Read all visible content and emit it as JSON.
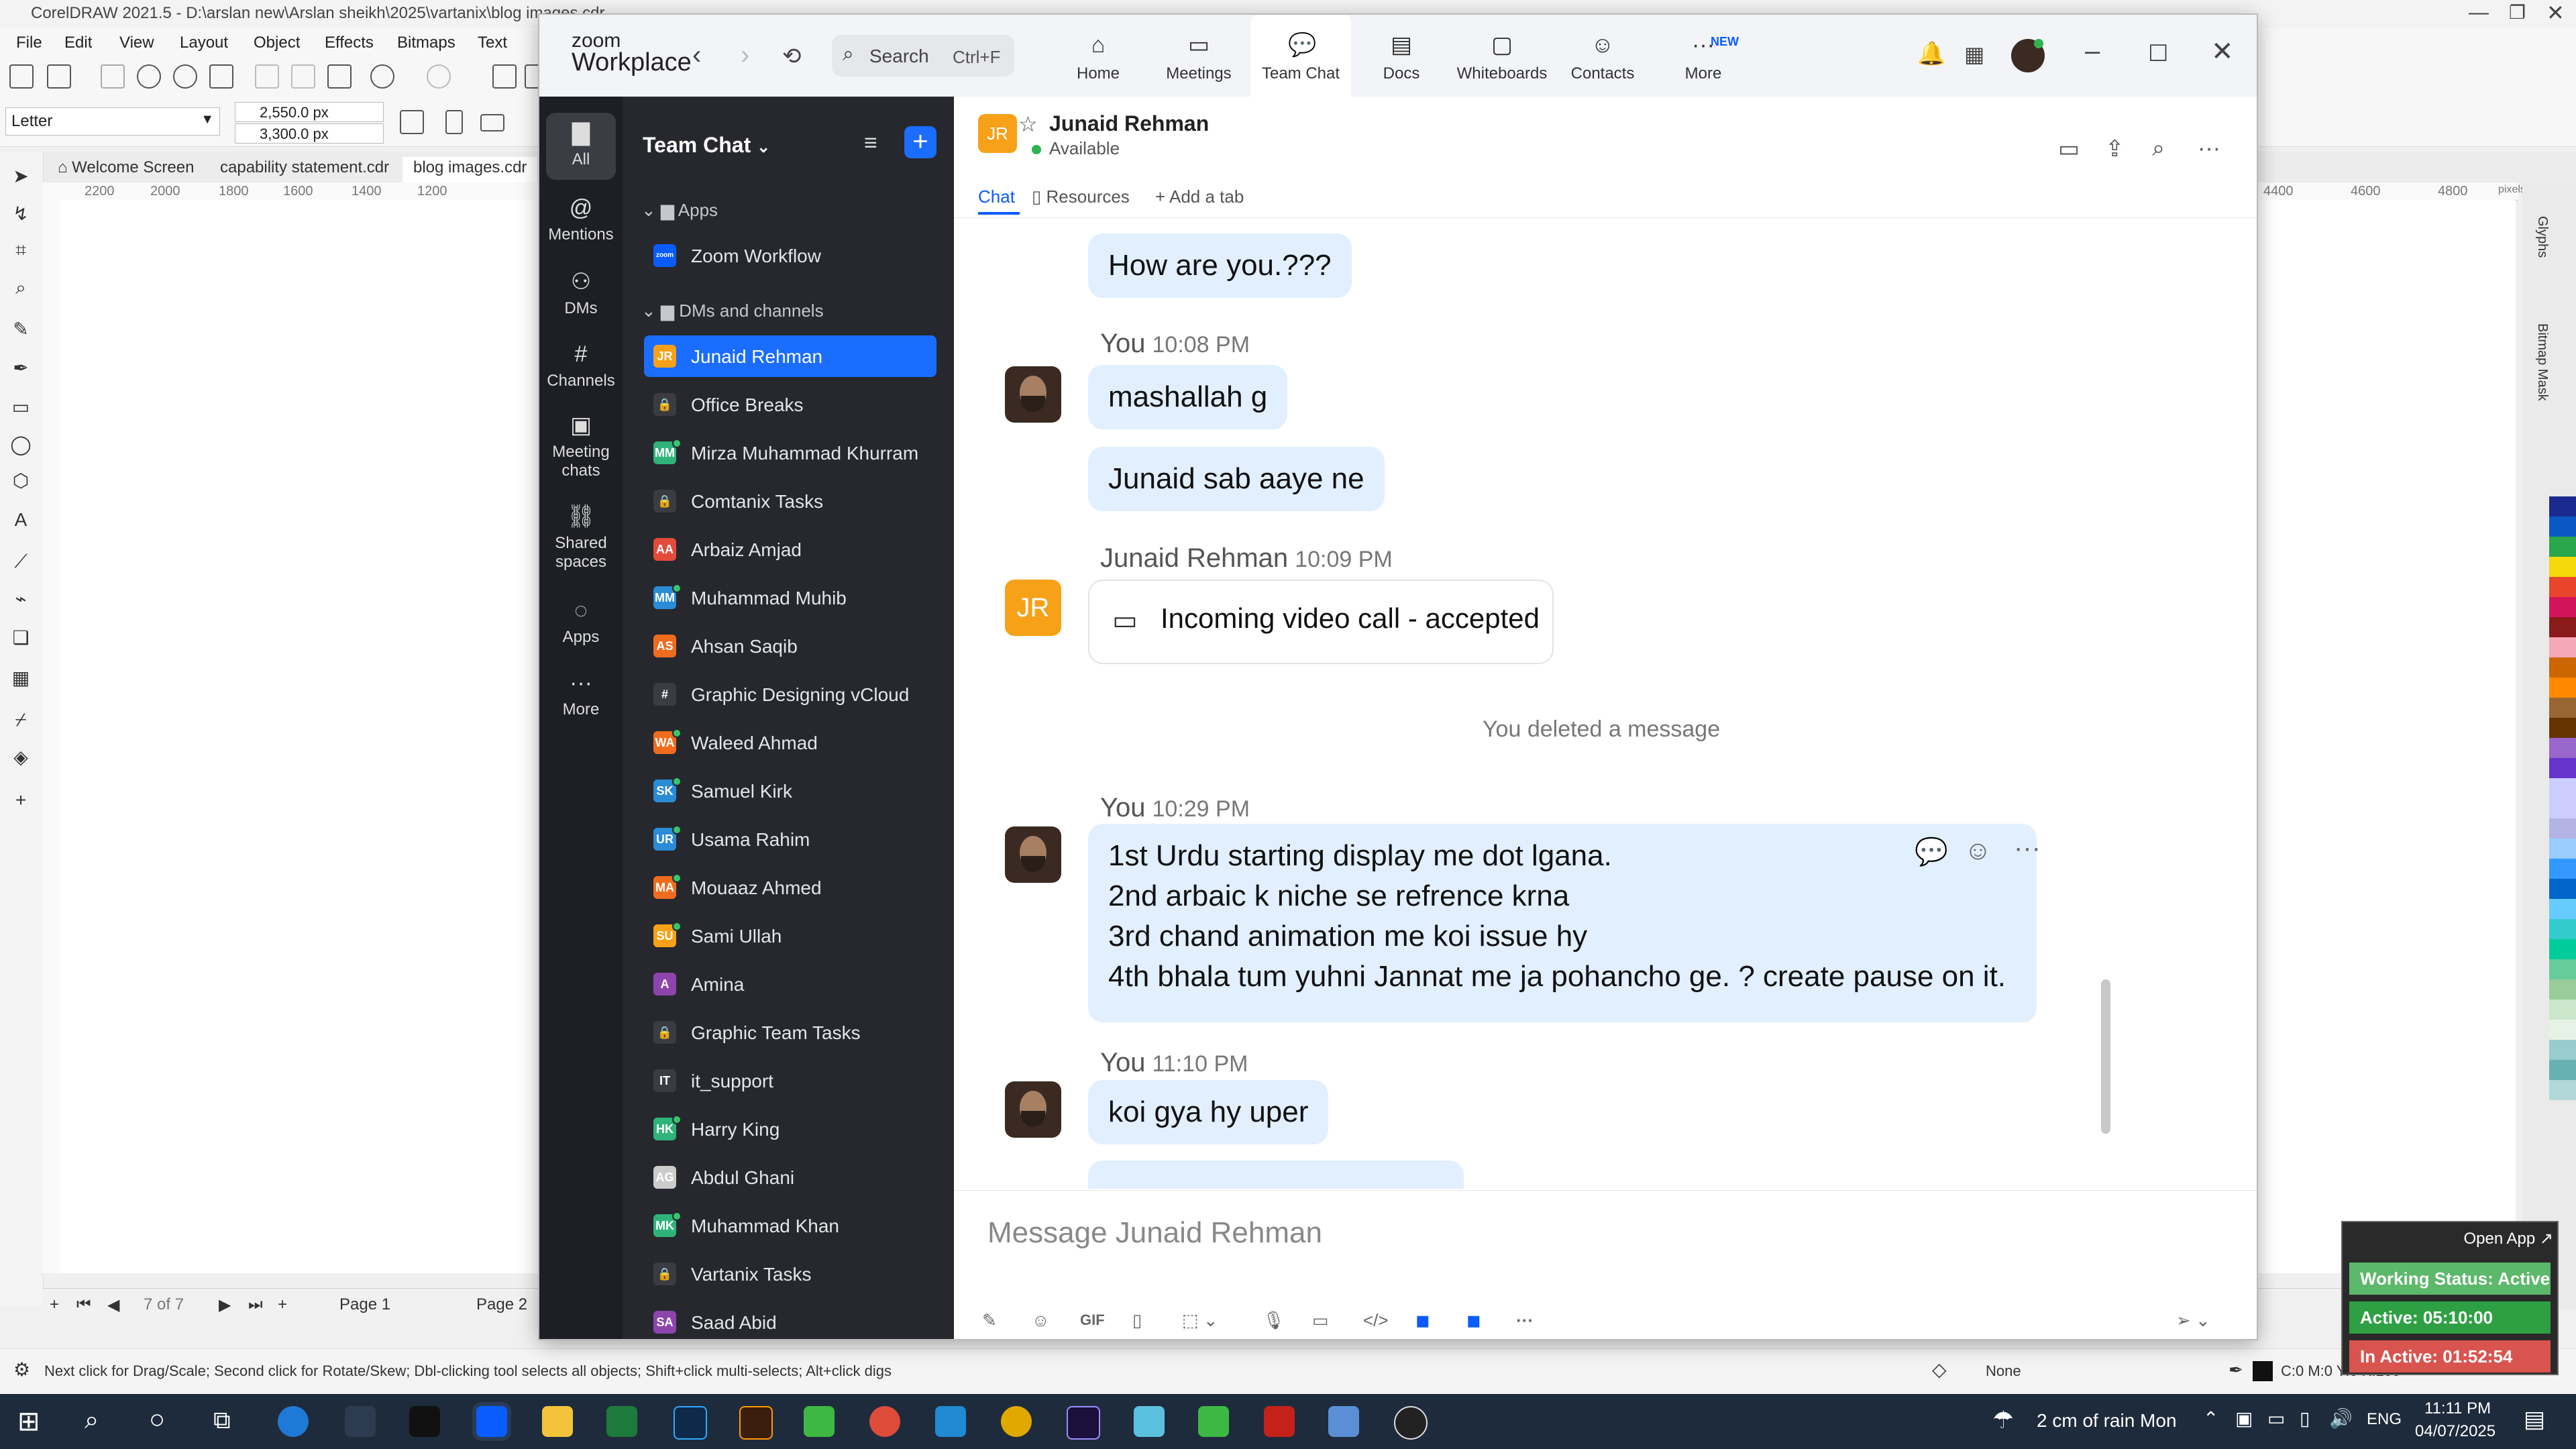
{
  "corel": {
    "title": "CorelDRAW 2021.5 - D:\\arslan new\\Arslan sheikh\\2025\\vartanix\\blog images.cdr",
    "menu": [
      "File",
      "Edit",
      "View",
      "Layout",
      "Object",
      "Effects",
      "Bitmaps",
      "Text"
    ],
    "paper_size": "Letter",
    "width_value": "2,550.0 px",
    "height_value": "3,300.0 px",
    "doc_tabs": [
      "Welcome Screen",
      "capability statement.cdr",
      "blog images.cdr"
    ],
    "ruler_left": [
      "2200",
      "2000",
      "1800",
      "1600",
      "1400",
      "1200"
    ],
    "ruler_right": [
      "4400",
      "4600",
      "4800"
    ],
    "ruler_unit": "pixels",
    "page_counter": "7 of 7",
    "pages": [
      "Page 1",
      "Page 2"
    ],
    "docker_labels": [
      "Glyphs",
      "Bitmap Mask"
    ],
    "status_hint": "Next click for Drag/Scale; Second click for Rotate/Skew; Dbl-clicking tool selects all objects; Shift+click multi-selects; Alt+click digs",
    "fill_none": "None",
    "color_readout": "C:0 M:0 Y:0 K:100",
    "palette": [
      "#1b2a8f",
      "#0b58c4",
      "#2aa64b",
      "#f5d90a",
      "#e8452c",
      "#d4145a",
      "#8b1a1a",
      "#f7a8b8",
      "#cc6600",
      "#ff8800",
      "#996633",
      "#663300",
      "#9966cc",
      "#6633cc",
      "#ccccff",
      "#ccccff",
      "#b3b3e6",
      "#99ccff",
      "#3399ff",
      "#0066cc",
      "#66ccff",
      "#33cccc",
      "#00cc99",
      "#66cc99",
      "#99cc99",
      "#cce6cc",
      "#e6f2e6",
      "#99cccc",
      "#66b2b2",
      "#b2d8d8"
    ]
  },
  "zoom": {
    "brand_top": "zoom",
    "brand_bottom": "Workplace",
    "search_label": "Search",
    "search_shortcut": "Ctrl+F",
    "nav": [
      {
        "label": "Home",
        "icon": "home-icon"
      },
      {
        "label": "Meetings",
        "icon": "video-camera-icon"
      },
      {
        "label": "Team Chat",
        "icon": "chat-bubbles-icon"
      },
      {
        "label": "Docs",
        "icon": "document-icon"
      },
      {
        "label": "Whiteboards",
        "icon": "whiteboard-icon"
      },
      {
        "label": "Contacts",
        "icon": "contacts-icon"
      },
      {
        "label": "More",
        "icon": "more-dots-icon",
        "badge": "NEW"
      }
    ],
    "rail": [
      {
        "label": "All",
        "icon": "chat-icon"
      },
      {
        "label": "Mentions",
        "icon": "at-icon"
      },
      {
        "label": "DMs",
        "icon": "people-icon"
      },
      {
        "label": "Channels",
        "icon": "hash-icon"
      },
      {
        "label": "Meeting chats",
        "icon": "calendar-icon"
      },
      {
        "label": "Shared spaces",
        "icon": "share-icon"
      },
      {
        "label": "Apps",
        "icon": "apps-icon"
      },
      {
        "label": "More",
        "icon": "ellipsis-icon"
      }
    ],
    "list_title": "Team Chat",
    "section_apps": "Apps",
    "app_item": "Zoom Workflow",
    "app_badge": "zoom",
    "section_dms": "DMs and channels",
    "contacts": [
      {
        "label": "Junaid Rehman",
        "initials": "JR",
        "color": "#f6a117",
        "active": true,
        "online": false
      },
      {
        "label": "Office Breaks",
        "initials": "🔒",
        "color": "#3a3c42",
        "online": false
      },
      {
        "label": "Mirza Muhammad Khurram",
        "initials": "MM",
        "color": "#2fb37a",
        "online": true
      },
      {
        "label": "Comtanix Tasks",
        "initials": "🔒",
        "color": "#3a3c42",
        "online": false
      },
      {
        "label": "Arbaiz Amjad",
        "initials": "AA",
        "color": "#e34b3b",
        "online": false
      },
      {
        "label": "Muhammad Muhib",
        "initials": "MM",
        "color": "#2a8bd6",
        "online": true
      },
      {
        "label": "Ahsan Saqib",
        "initials": "AS",
        "color": "#ef6c1e",
        "online": false
      },
      {
        "label": "Graphic Designing vCloud",
        "initials": "#",
        "color": "#3a3c42",
        "online": false
      },
      {
        "label": "Waleed Ahmad",
        "initials": "WA",
        "color": "#ef6c1e",
        "online": true
      },
      {
        "label": "Samuel Kirk",
        "initials": "SK",
        "color": "#2a8bd6",
        "online": true
      },
      {
        "label": "Usama Rahim",
        "initials": "UR",
        "color": "#2a8bd6",
        "online": true
      },
      {
        "label": "Mouaaz Ahmed",
        "initials": "MA",
        "color": "#ef6c1e",
        "online": true
      },
      {
        "label": "Sami Ullah",
        "initials": "SU",
        "color": "#f6a117",
        "online": true
      },
      {
        "label": "Amina",
        "initials": "A",
        "color": "#8e44ad",
        "online": false
      },
      {
        "label": "Graphic Team Tasks",
        "initials": "🔒",
        "color": "#3a3c42",
        "online": false
      },
      {
        "label": "it_support",
        "initials": "IT",
        "color": "#3a3c42",
        "online": false
      },
      {
        "label": "Harry King",
        "initials": "HK",
        "color": "#2fb37a",
        "online": true
      },
      {
        "label": "Abdul Ghani",
        "initials": "AG",
        "color": "#cccccc",
        "online": false
      },
      {
        "label": "Muhammad Khan",
        "initials": "MK",
        "color": "#2fb37a",
        "online": true
      },
      {
        "label": "Vartanix Tasks",
        "initials": "🔒",
        "color": "#3a3c42",
        "online": false
      },
      {
        "label": "Saad Abid",
        "initials": "SA",
        "color": "#8e44ad",
        "online": false
      }
    ],
    "chat": {
      "name": "Junaid Rehman",
      "initials": "JR",
      "status": "Available",
      "tabs": [
        "Chat",
        "Resources",
        "Add a tab"
      ],
      "messages": {
        "m1": "How are you.???",
        "g2_sender": "You",
        "g2_time": "10:08 PM",
        "m2": "mashallah g",
        "m3": "Junaid sab aaye ne",
        "g3_sender": "Junaid Rehman",
        "g3_time": "10:09 PM",
        "call": "Incoming video call - accepted",
        "deleted": "You deleted a message",
        "g4_sender": "You",
        "g4_time": "10:29 PM",
        "m4_lines": [
          "1st Urdu starting display me dot lgana.",
          "2nd arbaic k niche se refrence krna",
          "3rd chand animation me koi issue hy",
          "4th bhala tum yuhni Jannat me ja pohancho ge. ? create pause on it."
        ],
        "g5_sender": "You",
        "g5_time": "11:10 PM",
        "m5": "koi gya hy uper"
      },
      "composer_placeholder": "Message Junaid Rehman",
      "composer_tools": [
        "format-icon",
        "emoji-icon",
        "GIF",
        "file-icon",
        "screenshot-icon",
        "mic-icon",
        "video-icon",
        "code-icon",
        "app1-icon",
        "app2-icon",
        "more-icon"
      ]
    }
  },
  "widget": {
    "open_app": "Open App ↗",
    "working": "Working Status: Active",
    "active": "Active: 05:10:00",
    "inactive": "In Active: 01:52:54",
    "colors": {
      "working": "#5cb86a",
      "active": "#2ea043",
      "inactive": "#d9534f"
    }
  },
  "taskbar": {
    "weather": "2 cm of rain Mon",
    "lang": "ENG",
    "time": "11:11 PM",
    "date": "04/07/2025"
  }
}
